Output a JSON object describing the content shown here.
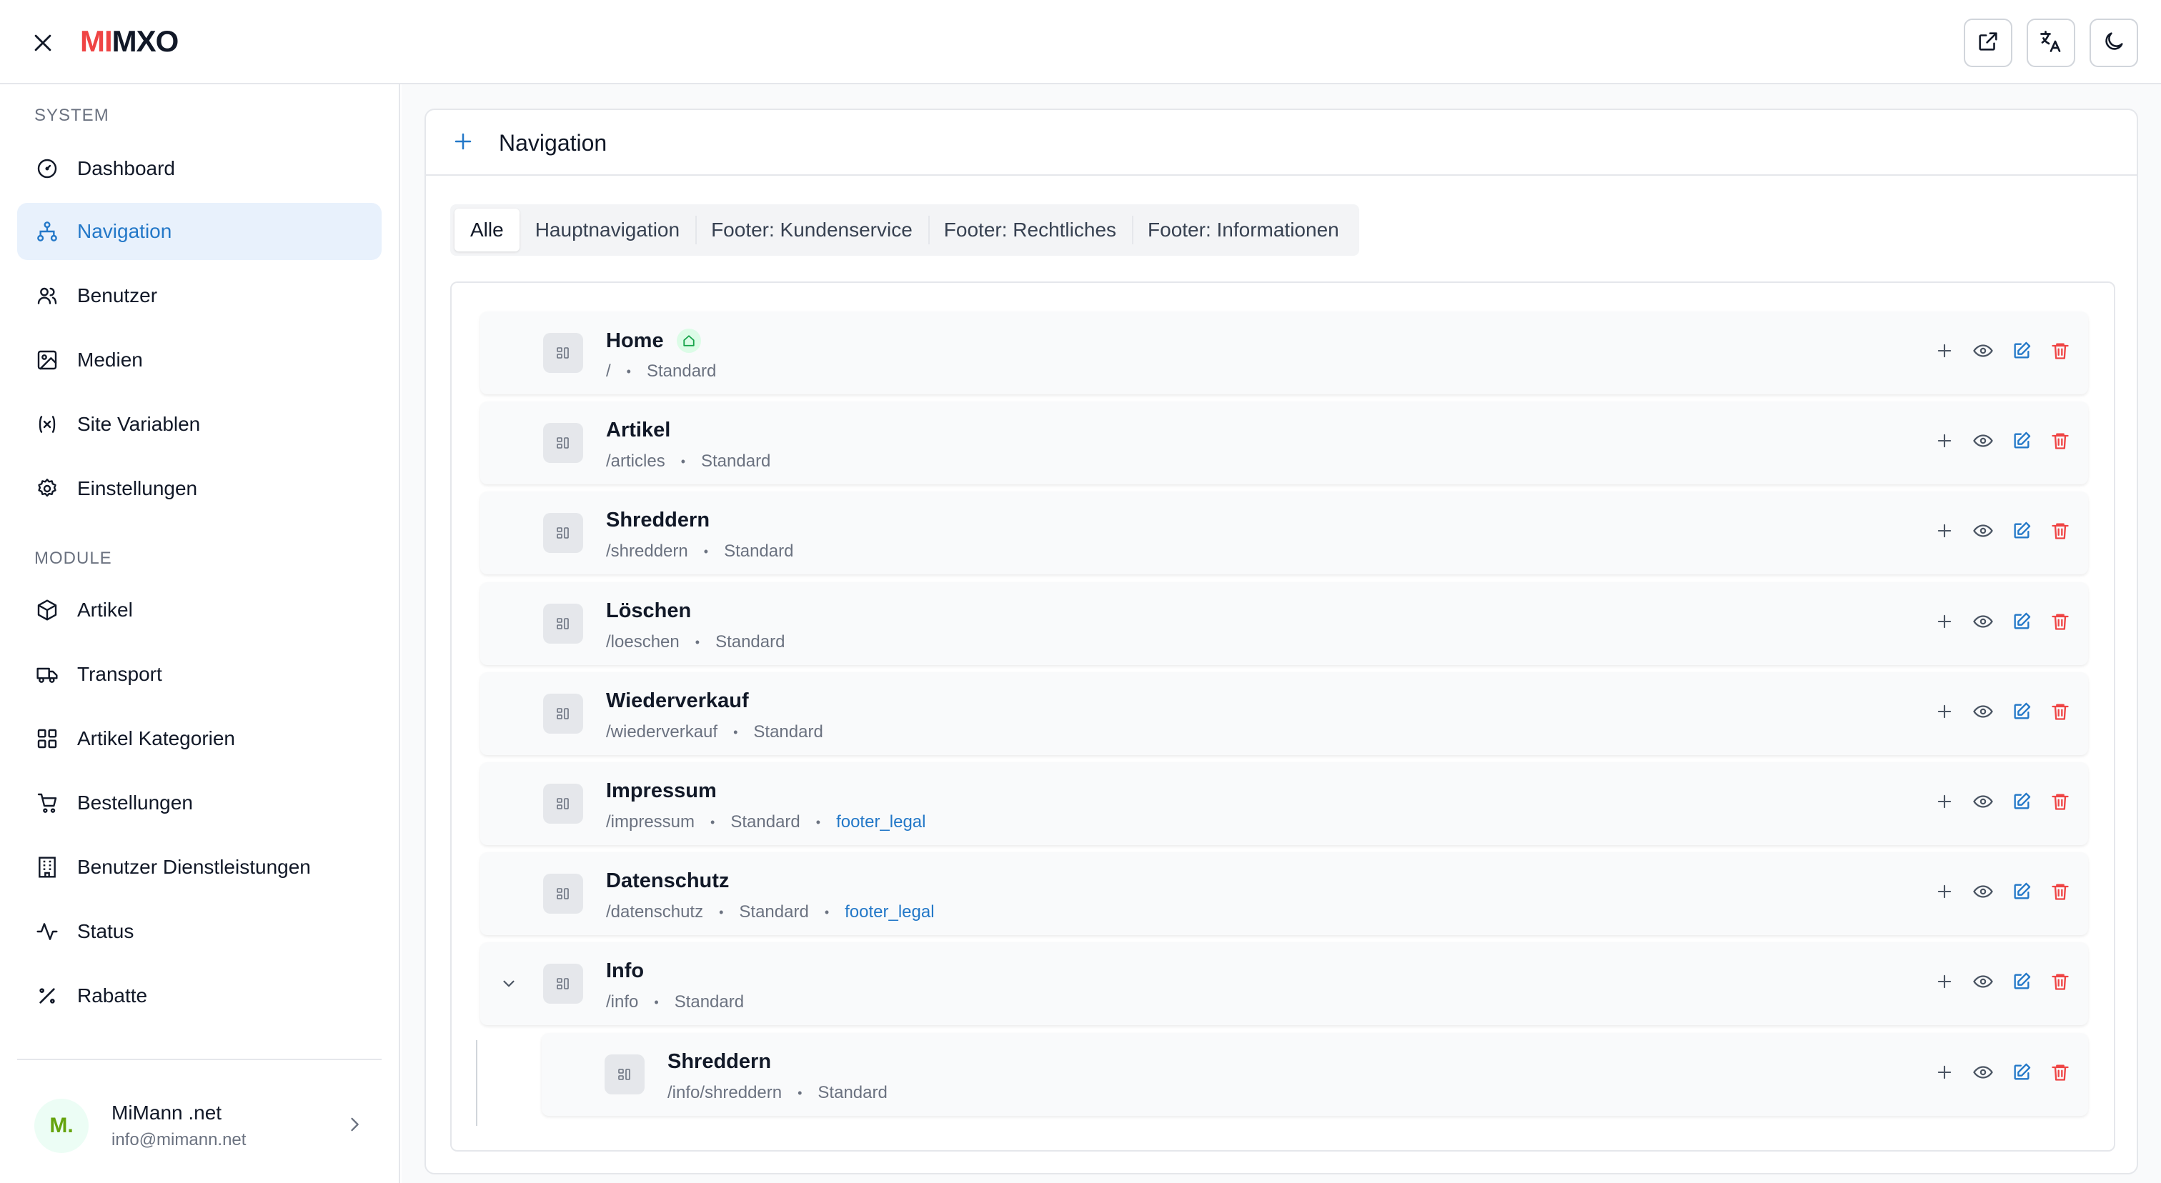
{
  "app": {
    "logo_accent": "MI",
    "logo_rest": "MXO",
    "colors": {
      "accent": "#2378c8",
      "logo_red": "#ef4444",
      "danger": "#ef4444",
      "success": "#16a34a"
    }
  },
  "header": {
    "icons": [
      "close-icon",
      "external-link-icon",
      "translate-icon",
      "moon-icon"
    ]
  },
  "sidebar": {
    "system_label": "SYSTEM",
    "system_items": [
      {
        "label": "Dashboard",
        "icon": "gauge-icon"
      },
      {
        "label": "Navigation",
        "icon": "sitemap-icon",
        "active": true
      },
      {
        "label": "Benutzer",
        "icon": "users-icon"
      },
      {
        "label": "Medien",
        "icon": "image-icon"
      },
      {
        "label": "Site Variablen",
        "icon": "variable-icon"
      },
      {
        "label": "Einstellungen",
        "icon": "gear-icon"
      }
    ],
    "module_label": "MODULE",
    "module_items": [
      {
        "label": "Artikel",
        "icon": "box-icon"
      },
      {
        "label": "Transport",
        "icon": "truck-icon"
      },
      {
        "label": "Artikel Kategorien",
        "icon": "grid-icon"
      },
      {
        "label": "Bestellungen",
        "icon": "cart-icon"
      },
      {
        "label": "Benutzer Dienstleistungen",
        "icon": "building-icon"
      },
      {
        "label": "Status",
        "icon": "activity-icon"
      },
      {
        "label": "Rabatte",
        "icon": "percent-icon"
      }
    ],
    "user": {
      "initials": "M.",
      "name": "MiMann .net",
      "email": "info@mimann.net"
    }
  },
  "main": {
    "title": "Navigation",
    "tabs": [
      "Alle",
      "Hauptnavigation",
      "Footer: Kundenservice",
      "Footer: Rechtliches",
      "Footer: Informationen"
    ],
    "active_tab": "Alle",
    "items": [
      {
        "title": "Home",
        "path": "/",
        "type": "Standard",
        "home": true
      },
      {
        "title": "Artikel",
        "path": "/articles",
        "type": "Standard"
      },
      {
        "title": "Shreddern",
        "path": "/shreddern",
        "type": "Standard"
      },
      {
        "title": "Löschen",
        "path": "/loeschen",
        "type": "Standard"
      },
      {
        "title": "Wiederverkauf",
        "path": "/wiederverkauf",
        "type": "Standard"
      },
      {
        "title": "Impressum",
        "path": "/impressum",
        "type": "Standard",
        "tag": "footer_legal"
      },
      {
        "title": "Datenschutz",
        "path": "/datenschutz",
        "type": "Standard",
        "tag": "footer_legal"
      },
      {
        "title": "Info",
        "path": "/info",
        "type": "Standard",
        "expanded": true
      },
      {
        "title": "Shreddern",
        "path": "/info/shreddern",
        "type": "Standard",
        "child": true
      }
    ]
  }
}
